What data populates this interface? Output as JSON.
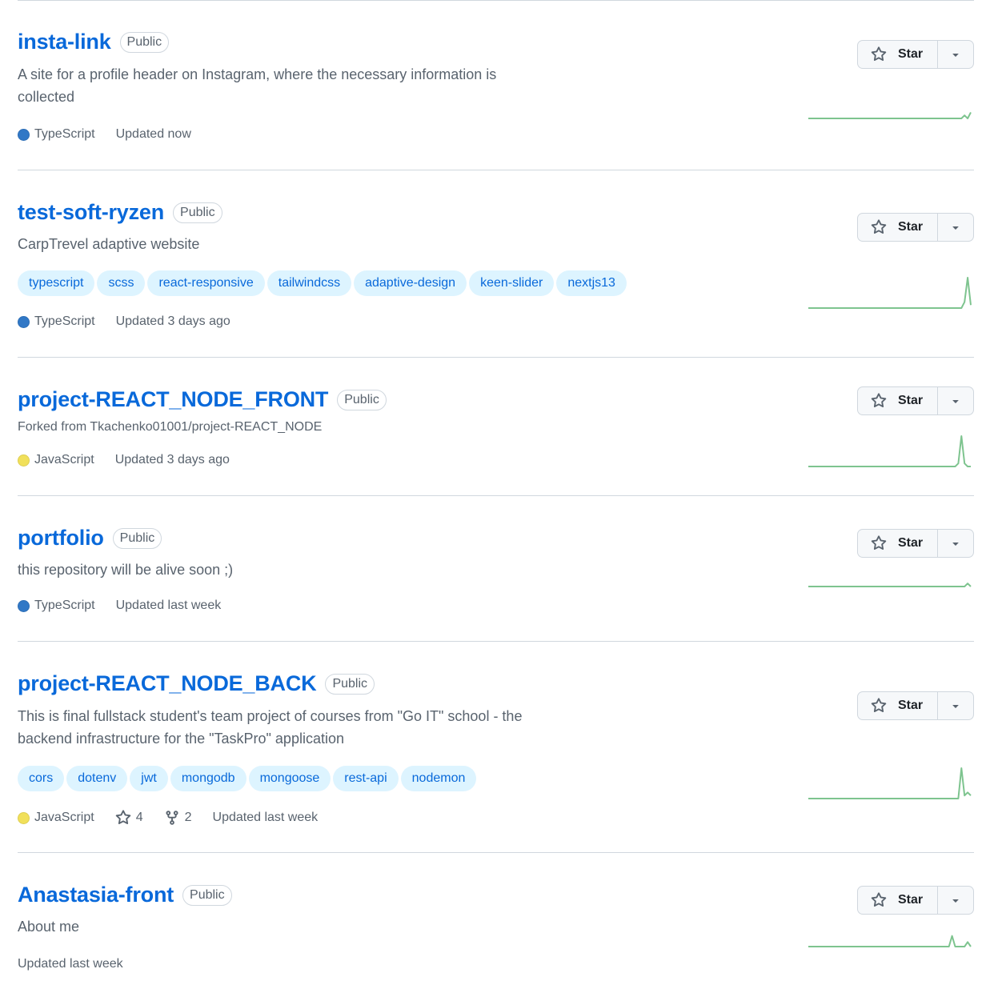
{
  "visibility_label": "Public",
  "star_label": "Star",
  "colors": {
    "link": "#0969da",
    "TypeScript": "#3178c6",
    "JavaScript": "#f1e05a",
    "spark": "#7ec48f"
  },
  "repos": [
    {
      "name": "insta-link",
      "description": "A site for a profile header on Instagram, where the necessary information is collected",
      "language": "TypeScript",
      "updated": "Updated now",
      "sparkline": [
        0,
        0,
        0,
        0,
        0,
        0,
        0,
        0,
        0,
        0,
        0,
        0,
        0,
        0,
        0,
        0,
        0,
        0,
        0,
        0,
        0,
        0,
        0,
        0,
        0,
        0,
        0,
        0,
        0,
        0,
        0,
        0,
        0,
        0,
        0,
        0,
        0,
        0,
        0,
        0,
        0,
        0,
        0,
        0,
        0,
        0,
        0,
        0,
        0,
        0,
        0.1,
        0,
        0.2
      ]
    },
    {
      "name": "test-soft-ryzen",
      "description": "CarpTrevel adaptive website",
      "topics": [
        "typescript",
        "scss",
        "react-responsive",
        "tailwindcss",
        "adaptive-design",
        "keen-slider",
        "nextjs13"
      ],
      "language": "TypeScript",
      "updated": "Updated 3 days ago",
      "sparkline": [
        0,
        0,
        0,
        0,
        0,
        0,
        0,
        0,
        0,
        0,
        0,
        0,
        0,
        0,
        0,
        0,
        0,
        0,
        0,
        0,
        0,
        0,
        0,
        0,
        0,
        0,
        0,
        0,
        0,
        0,
        0,
        0,
        0,
        0,
        0,
        0,
        0,
        0,
        0,
        0,
        0,
        0,
        0,
        0,
        0,
        0,
        0,
        0,
        0,
        0,
        0.2,
        1,
        0.1
      ]
    },
    {
      "name": "project-REACT_NODE_FRONT",
      "fork": "Forked from Tkachenko01001/project-REACT_NODE",
      "language": "JavaScript",
      "updated": "Updated 3 days ago",
      "sparkline": [
        0,
        0,
        0,
        0,
        0,
        0,
        0,
        0,
        0,
        0,
        0,
        0,
        0,
        0,
        0,
        0,
        0,
        0,
        0,
        0,
        0,
        0,
        0,
        0,
        0,
        0,
        0,
        0,
        0,
        0,
        0,
        0,
        0,
        0,
        0,
        0,
        0,
        0,
        0,
        0,
        0,
        0,
        0,
        0,
        0,
        0,
        0,
        0,
        0.1,
        1,
        0.1,
        0,
        0
      ]
    },
    {
      "name": "portfolio",
      "description": "this repository will be alive soon ;)",
      "language": "TypeScript",
      "updated": "Updated last week",
      "sparkline": [
        0,
        0,
        0,
        0,
        0,
        0,
        0,
        0,
        0,
        0,
        0,
        0,
        0,
        0,
        0,
        0,
        0,
        0,
        0,
        0,
        0,
        0,
        0,
        0,
        0,
        0,
        0,
        0,
        0,
        0,
        0,
        0,
        0,
        0,
        0,
        0,
        0,
        0,
        0,
        0,
        0,
        0,
        0,
        0,
        0,
        0,
        0,
        0,
        0,
        0,
        0,
        0.1,
        0
      ]
    },
    {
      "name": "project-REACT_NODE_BACK",
      "description": "This is final fullstack student's team project of courses from \"Go IT\" school - the backend infrastructure for the \"TaskPro\" application",
      "topics": [
        "cors",
        "dotenv",
        "jwt",
        "mongodb",
        "mongoose",
        "rest-api",
        "nodemon"
      ],
      "language": "JavaScript",
      "stars": "4",
      "forks": "2",
      "updated": "Updated last week",
      "sparkline": [
        0,
        0,
        0,
        0,
        0,
        0,
        0,
        0,
        0,
        0,
        0,
        0,
        0,
        0,
        0,
        0,
        0,
        0,
        0,
        0,
        0,
        0,
        0,
        0,
        0,
        0,
        0,
        0,
        0,
        0,
        0,
        0,
        0,
        0,
        0,
        0,
        0,
        0,
        0,
        0,
        0,
        0,
        0,
        0,
        0,
        0,
        0,
        0,
        0,
        1,
        0.1,
        0.2,
        0.1
      ]
    },
    {
      "name": "Anastasia-front",
      "description": "About me",
      "updated": "Updated last week",
      "sparkline": [
        0,
        0,
        0,
        0,
        0,
        0,
        0,
        0,
        0,
        0,
        0,
        0,
        0,
        0,
        0,
        0,
        0,
        0,
        0,
        0,
        0,
        0,
        0,
        0,
        0,
        0,
        0,
        0,
        0,
        0,
        0,
        0,
        0,
        0,
        0,
        0,
        0,
        0,
        0,
        0,
        0,
        0,
        0,
        0,
        0,
        0,
        0.35,
        0,
        0,
        0,
        0,
        0.15,
        0
      ]
    }
  ]
}
